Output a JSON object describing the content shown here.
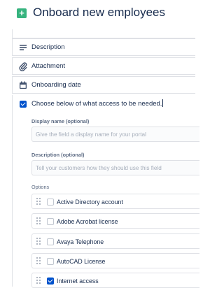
{
  "header": {
    "plus_glyph": "+",
    "title": "Onboard new employees"
  },
  "fields": [
    {
      "label": "Description",
      "icon": "description-lines-icon"
    },
    {
      "label": "Attachment",
      "icon": "paperclip-icon"
    },
    {
      "label": "Onboarding date",
      "icon": "calendar-icon"
    }
  ],
  "access_field": {
    "label": "Choose below of what access to be needed.",
    "checked": true,
    "display_name": {
      "label": "Display name (optional)",
      "placeholder": "Give the field a display name for your portal"
    },
    "description": {
      "label": "Description (optional)",
      "placeholder": "Tell your customers how they should use this field"
    },
    "options_label": "Options",
    "options": [
      {
        "label": "Active Directory account",
        "checked": false
      },
      {
        "label": "Adobe Acrobat license",
        "checked": false
      },
      {
        "label": "Avaya Telephone",
        "checked": false
      },
      {
        "label": "AutoCAD License",
        "checked": false
      },
      {
        "label": "Internet access",
        "checked": true
      }
    ]
  },
  "colors": {
    "accent": "#0052cc",
    "add": "#36b37e",
    "border": "#dfe1e6",
    "muted": "#5e6c84"
  }
}
